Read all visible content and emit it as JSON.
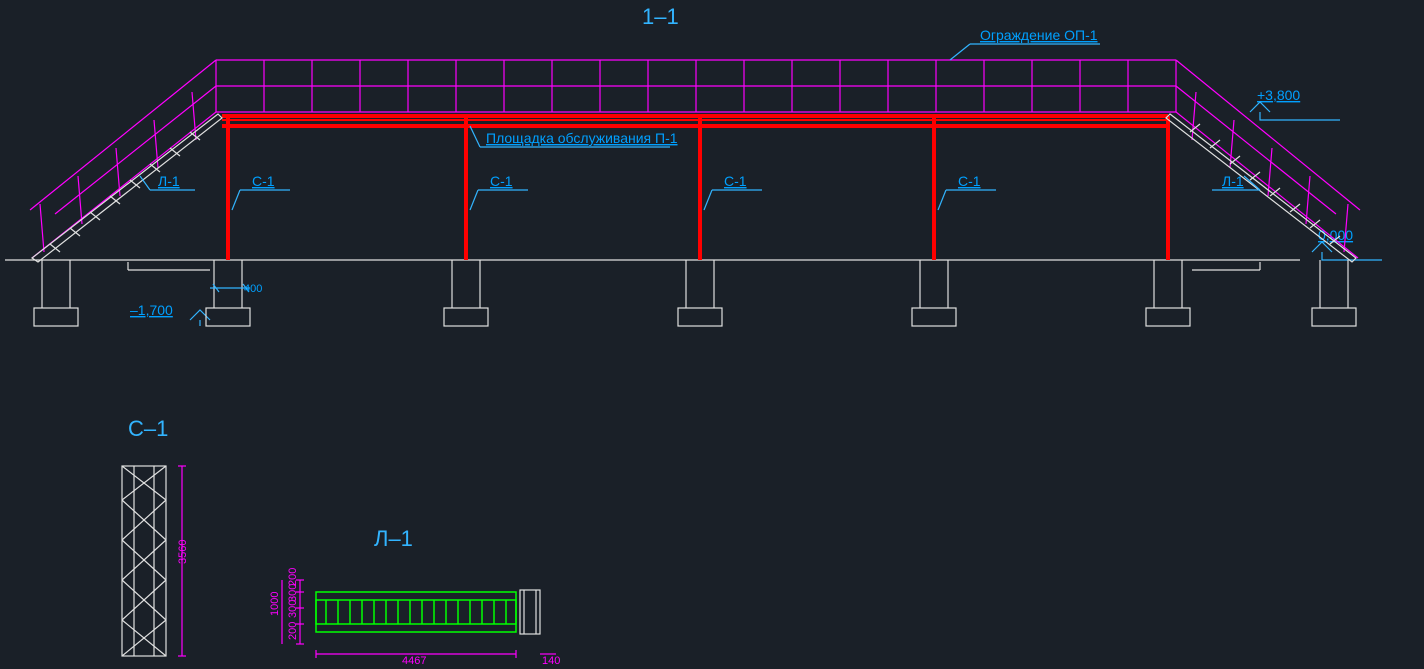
{
  "section": {
    "title": "1–1",
    "railing_label": "Ограждение ОП-1",
    "platform_label": "Площадка обслуживания П-1",
    "stair_label_left": "Л-1",
    "stair_label_right": "Л-1",
    "column_labels": [
      "С-1",
      "С-1",
      "С-1",
      "С-1"
    ],
    "elev_top": "+3,800",
    "elev_ground": "0,000",
    "elev_foot": "–1,700",
    "dim_footing_offset": "400"
  },
  "detail_column": {
    "title": "С–1",
    "height_dim": "3560"
  },
  "detail_stair": {
    "title": "Л–1",
    "dims_left": [
      "200",
      "300",
      "300",
      "200"
    ],
    "dim_left_total": "1000",
    "dim_bottom": "4467",
    "dim_right": "140"
  }
}
